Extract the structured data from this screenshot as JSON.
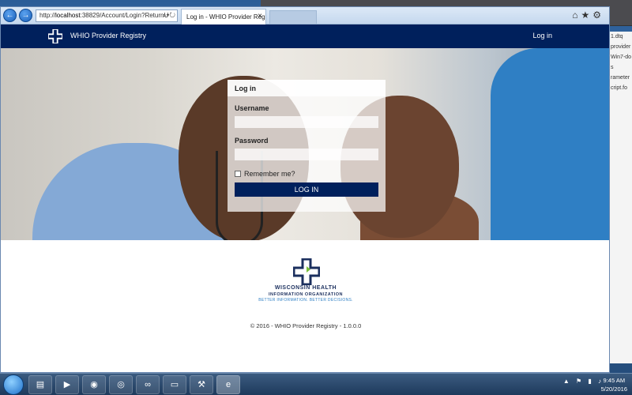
{
  "browser": {
    "address_prefix": "http://",
    "address_host": "localhost",
    "address_rest": ":38829/Account/Login?ReturnU",
    "tab_title": "Log in - WHIO Provider Regis...",
    "tab_close": "×"
  },
  "site": {
    "brand": "WHIO Provider Registry",
    "nav_login": "Log in"
  },
  "login": {
    "title": "Log in",
    "username_label": "Username",
    "username_value": "",
    "password_label": "Password",
    "password_value": "",
    "remember_label": "Remember me?",
    "remember_checked": false,
    "button_label": "LOG IN"
  },
  "footer": {
    "org_line1": "WISCONSIN HEALTH",
    "org_line2": "INFORMATION ORGANIZATION",
    "org_tagline": "BETTER INFORMATION. BETTER DECISIONS.",
    "copyright": "© 2016 - WHIO Provider Registry - 1.0.0.0"
  },
  "desktop": {
    "right_panel_items": [
      "1.dtq",
      "provider",
      "Win7-do",
      "s",
      "rameter",
      "cript.fo"
    ]
  },
  "taskbar": {
    "apps": [
      {
        "name": "explorer",
        "glyph": "▤"
      },
      {
        "name": "media-player",
        "glyph": "▶"
      },
      {
        "name": "chrome",
        "glyph": "◉"
      },
      {
        "name": "firefox",
        "glyph": "◎"
      },
      {
        "name": "visual-studio",
        "glyph": "∞"
      },
      {
        "name": "cmd",
        "glyph": "▭"
      },
      {
        "name": "tools",
        "glyph": "⚒"
      },
      {
        "name": "internet-explorer",
        "glyph": "e"
      }
    ],
    "time": "9:45 AM",
    "date": "5/20/2016"
  },
  "colors": {
    "navbar": "#00205c",
    "button": "#00205c",
    "accent": "#2f7fc4"
  }
}
